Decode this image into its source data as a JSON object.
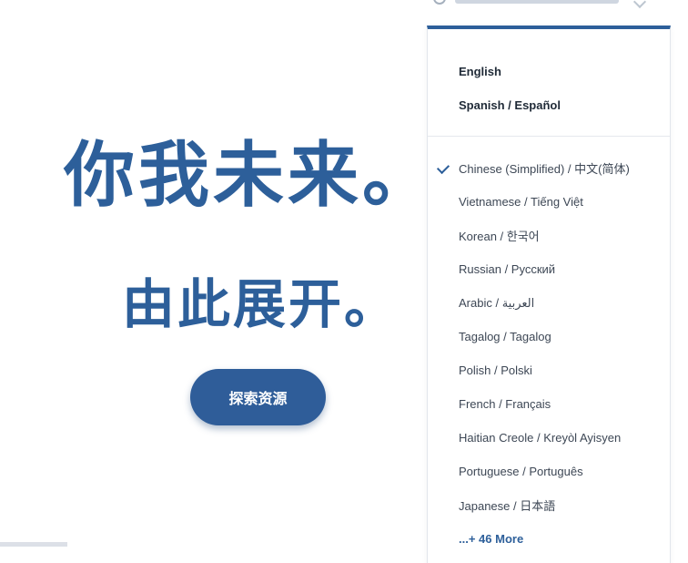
{
  "hero": {
    "title": "你我未来。",
    "subtitle": "由此展开。",
    "cta_label": "探索资源"
  },
  "language_menu": {
    "primary": [
      "English",
      "Spanish / Español"
    ],
    "secondary": [
      "Chinese (Simplified) / 中文(简体)",
      "Vietnamese / Tiếng Việt",
      "Korean / 한국어",
      "Russian / Русский",
      "Arabic / العربية",
      "Tagalog / Tagalog",
      "Polish / Polski",
      "French / Français",
      "Haitian Creole / Kreyòl Ayisyen",
      "Portuguese / Português",
      "Japanese / 日本語"
    ],
    "more": "...+ 46 More",
    "selected": "Chinese (Simplified) / 中文(简体)"
  },
  "colors": {
    "brand": "#2d5f9a",
    "menu_border": "#2d5f9a",
    "text": "#3d4755"
  },
  "icons": {
    "language_toggle": "globe-icon",
    "selected_marker": "check-icon"
  }
}
